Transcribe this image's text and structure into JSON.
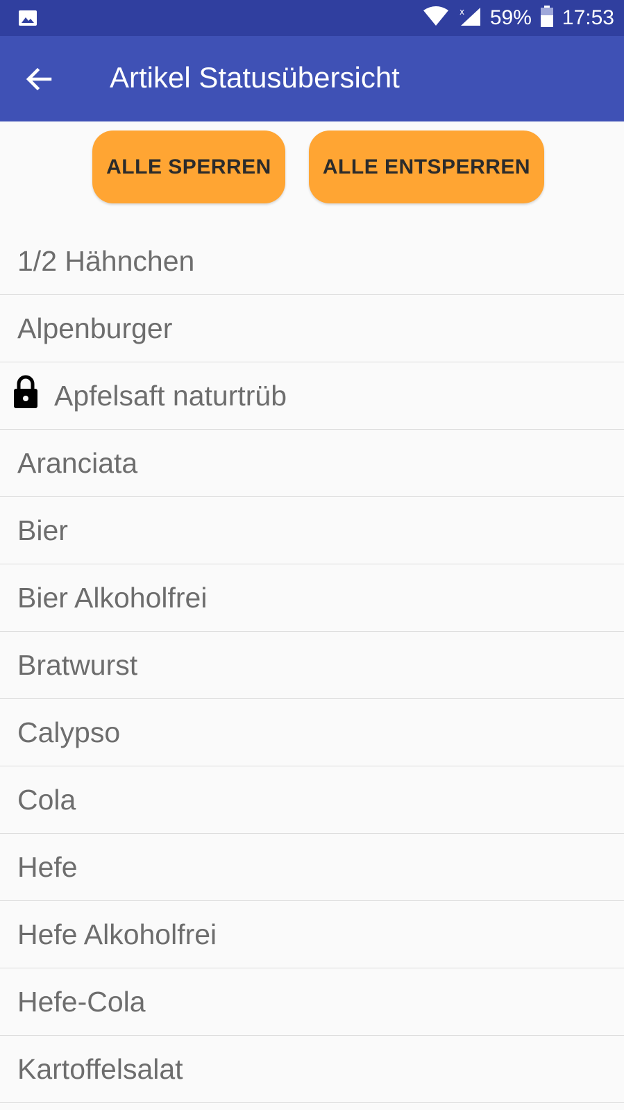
{
  "statusbar": {
    "battery": "59%",
    "time": "17:53",
    "icons": [
      "image-icon",
      "wifi-icon",
      "signal-icon",
      "battery-icon"
    ]
  },
  "appbar": {
    "title": "Artikel Statusübersicht"
  },
  "actions": {
    "lock_all": "ALLE SPERREN",
    "unlock_all": "ALLE ENTSPERREN"
  },
  "items": [
    {
      "label": "1/2 Hähnchen",
      "locked": false
    },
    {
      "label": "Alpenburger",
      "locked": false
    },
    {
      "label": "Apfelsaft naturtrüb",
      "locked": true
    },
    {
      "label": "Aranciata",
      "locked": false
    },
    {
      "label": "Bier",
      "locked": false
    },
    {
      "label": "Bier Alkoholfrei",
      "locked": false
    },
    {
      "label": "Bratwurst",
      "locked": false
    },
    {
      "label": "Calypso",
      "locked": false
    },
    {
      "label": "Cola",
      "locked": false
    },
    {
      "label": "Hefe",
      "locked": false
    },
    {
      "label": "Hefe Alkoholfrei",
      "locked": false
    },
    {
      "label": "Hefe-Cola",
      "locked": false
    },
    {
      "label": "Kartoffelsalat",
      "locked": false
    }
  ],
  "colors": {
    "statusbar": "#303f9f",
    "appbar": "#3f51b5",
    "button": "#ffa533",
    "text": "#6d6d6d"
  }
}
